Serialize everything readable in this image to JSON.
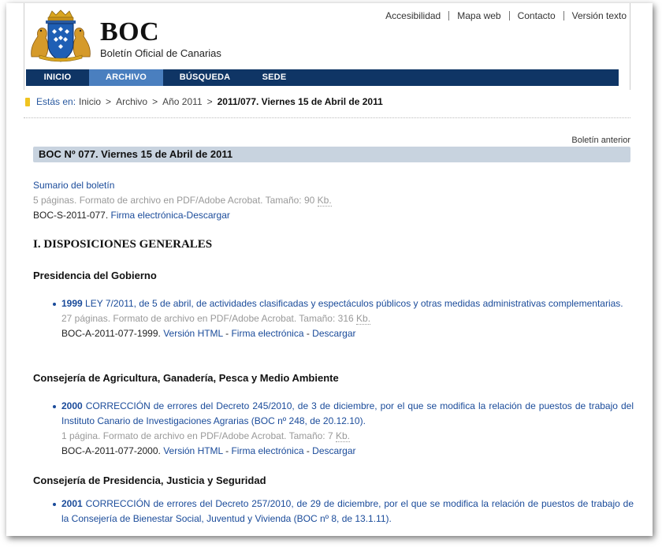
{
  "header": {
    "logo_title": "BOC",
    "logo_subtitle": "Boletín Oficial de Canarias",
    "top_links": [
      "Accesibilidad",
      "Mapa web",
      "Contacto",
      "Versión texto"
    ]
  },
  "nav": {
    "items": [
      "INICIO",
      "ARCHIVO",
      "BÚSQUEDA",
      "SEDE"
    ],
    "active": "ARCHIVO"
  },
  "breadcrumb": {
    "label": "Estás en:",
    "items": [
      "Inicio",
      "Archivo",
      "Año 2011"
    ],
    "separator": ">",
    "current": "2011/077. Viernes 15 de Abril de 2011"
  },
  "content": {
    "prev_link": "Boletín anterior",
    "title": "BOC Nº 077. Viernes 15 de Abril de 2011",
    "summary": {
      "link": "Sumario del boletín",
      "info": "5 páginas. Formato de archivo en PDF/Adobe Acrobat. Tamaño: 90",
      "kb": "Kb.",
      "code": "BOC-S-2011-077.",
      "sign_link": "Firma electrónica-Descargar"
    },
    "section_title": "I. DISPOSICIONES GENERALES",
    "departments": [
      {
        "name": "Presidencia del Gobierno",
        "entries": [
          {
            "number": "1999",
            "title": "LEY 7/2011, de 5 de abril, de actividades clasificadas y espectáculos públicos y otras medidas administrativas complementarias.",
            "info": "27 páginas. Formato de archivo en PDF/Adobe Acrobat. Tamaño: 316",
            "kb": "Kb.",
            "code": "BOC-A-2011-077-1999.",
            "html_link": "Versión HTML",
            "sign_link": "Firma electrónica",
            "download_link": "Descargar"
          }
        ]
      },
      {
        "name": "Consejería de Agricultura, Ganadería, Pesca y Medio Ambiente",
        "entries": [
          {
            "number": "2000",
            "title": "CORRECCIÓN de errores del Decreto 245/2010, de 3 de diciembre, por el que se modifica la relación de puestos de trabajo del Instituto Canario de Investigaciones Agrarias (BOC nº 248, de 20.12.10).",
            "info": "1 página. Formato de archivo en PDF/Adobe Acrobat. Tamaño: 7",
            "kb": "Kb.",
            "code": "BOC-A-2011-077-2000.",
            "html_link": "Versión HTML",
            "sign_link": "Firma electrónica",
            "download_link": "Descargar"
          }
        ]
      },
      {
        "name": "Consejería de Presidencia, Justicia y Seguridad",
        "entries": [
          {
            "number": "2001",
            "title": "CORRECCIÓN de errores del Decreto 257/2010, de 29 de diciembre, por el que se modifica la relación de puestos de trabajo de la Consejería de Bienestar Social, Juventud y Vivienda (BOC nº 8, de 13.1.11)."
          }
        ]
      }
    ]
  },
  "colors": {
    "nav_bg": "#0f3565",
    "nav_active": "#4a7fbf",
    "link": "#1a4b9a",
    "title_bar": "#c8d3df",
    "bullet_yellow": "#f0c420"
  }
}
